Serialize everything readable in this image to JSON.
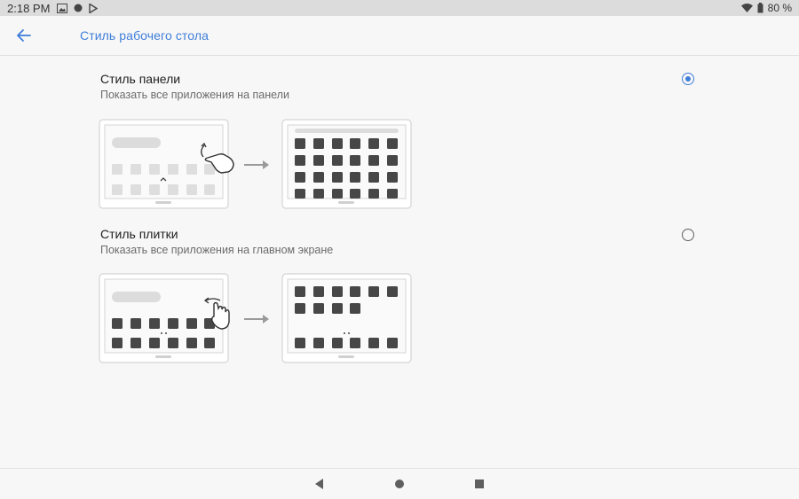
{
  "status_bar": {
    "time": "2:18 PM",
    "battery": "80 %",
    "icons": [
      "image-icon",
      "circle-notification-icon",
      "play-store-icon",
      "wifi-icon",
      "battery-icon"
    ]
  },
  "app_bar": {
    "title": "Стиль рабочего стола",
    "back_icon": "arrow-back-icon"
  },
  "options": [
    {
      "title": "Стиль панели",
      "subtitle": "Показать все приложения на панели",
      "selected": true
    },
    {
      "title": "Стиль плитки",
      "subtitle": "Показать все приложения на главном экране",
      "selected": false
    }
  ],
  "nav_bar": {
    "icons": [
      "back-triangle-icon",
      "home-circle-icon",
      "recents-square-icon"
    ]
  },
  "colors": {
    "accent": "#3f7ed9",
    "status_bar_bg": "#dcdcdc",
    "background": "#f7f7f7"
  }
}
